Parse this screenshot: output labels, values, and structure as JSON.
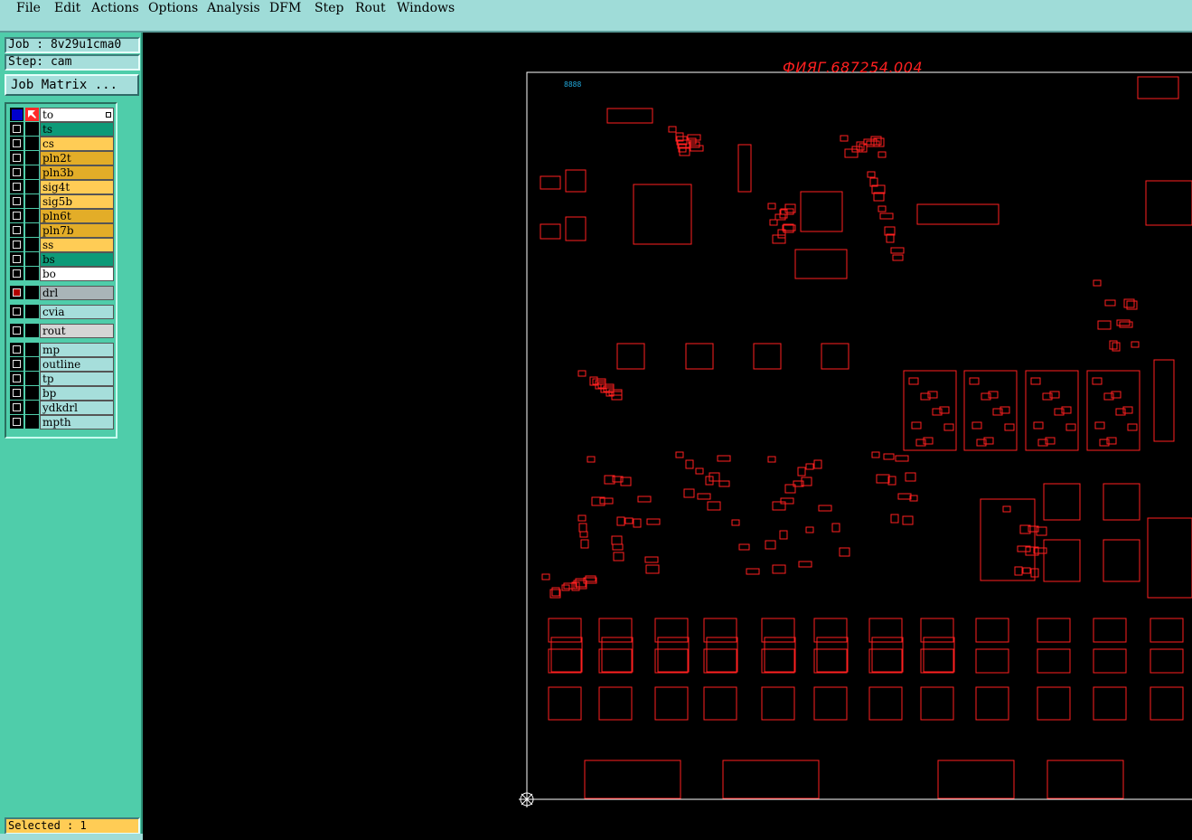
{
  "menu": [
    "File",
    "Edit",
    "Actions",
    "Options",
    "Analysis",
    "DFM",
    "Step",
    "Rout",
    "Windows"
  ],
  "job_label": "Job : 8v29u1cma0",
  "step_label": "Step: cam",
  "job_matrix_button": "Job Matrix ...",
  "layers": [
    {
      "name": "to",
      "color": "#ffffff",
      "active": true
    },
    {
      "name": "ts",
      "color": "#0d9a78"
    },
    {
      "name": "cs",
      "color": "#ffcc55"
    },
    {
      "name": "pln2t",
      "color": "#e3ad28"
    },
    {
      "name": "pln3b",
      "color": "#e3ad28"
    },
    {
      "name": "sig4t",
      "color": "#ffcc55"
    },
    {
      "name": "sig5b",
      "color": "#ffcc55"
    },
    {
      "name": "pln6t",
      "color": "#e3ad28"
    },
    {
      "name": "pln7b",
      "color": "#e3ad28"
    },
    {
      "name": "ss",
      "color": "#ffcc55"
    },
    {
      "name": "bs",
      "color": "#0d9a78"
    },
    {
      "name": "bo",
      "color": "#ffffff"
    },
    {
      "name": "drl",
      "color": "#a9b5b8"
    },
    {
      "name": "cvia",
      "color": "#a6dedb"
    },
    {
      "name": "rout",
      "color": "#d5d5d5"
    },
    {
      "name": "mp",
      "color": "#a6dedb"
    },
    {
      "name": "outline",
      "color": "#a6dedb"
    },
    {
      "name": "tp",
      "color": "#a6dedb"
    },
    {
      "name": "bp",
      "color": "#a6dedb"
    },
    {
      "name": "ydkdrl",
      "color": "#a6dedb"
    },
    {
      "name": "mpth",
      "color": "#a6dedb"
    }
  ],
  "selected_status": "Selected : 1",
  "board": {
    "title": "ФИЯГ.687254.004",
    "mark": "8888",
    "line_color": "#ff2020",
    "outline_color": "#ffffff"
  }
}
